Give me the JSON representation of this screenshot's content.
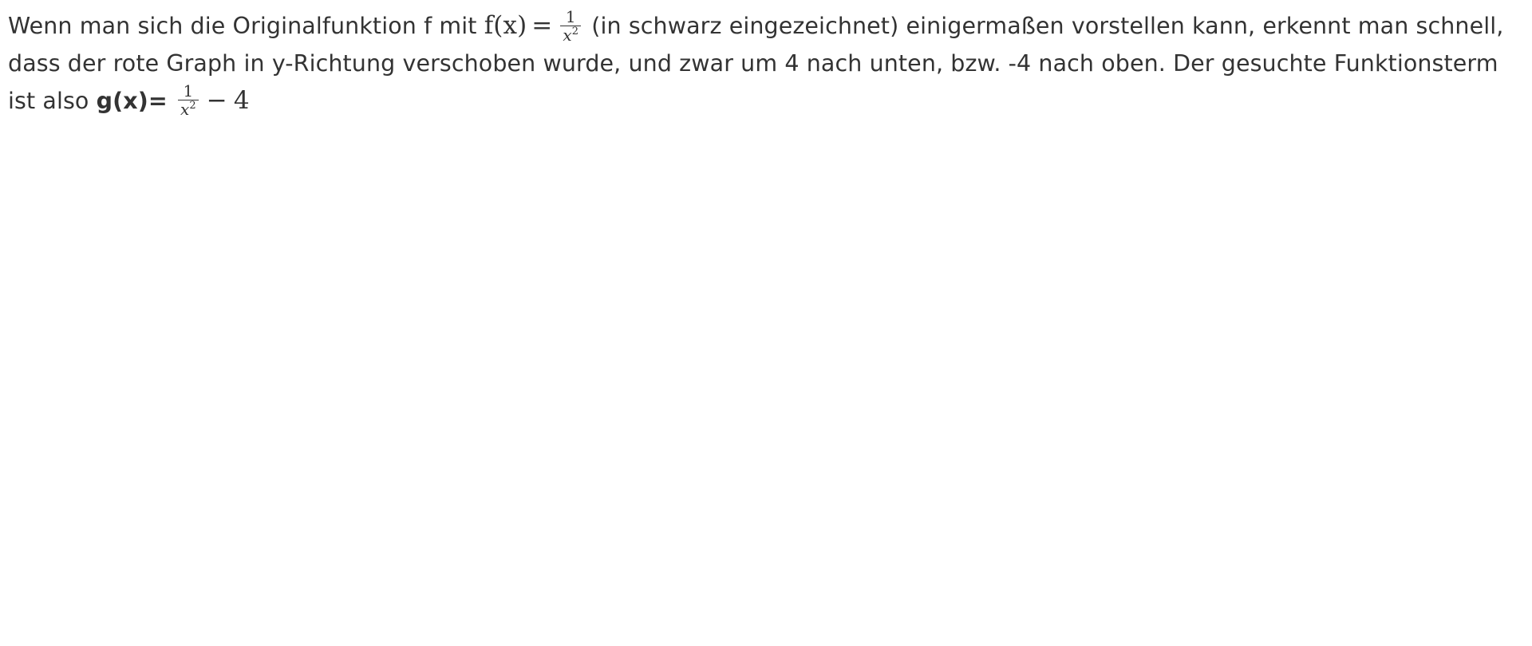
{
  "paragraph": {
    "text_1": "Wenn man sich die Originalfunktion f mit ",
    "f_name": "f",
    "f_lparen": "(",
    "f_var": "x",
    "f_rparen": ")",
    "equals": "=",
    "frac_1_numerator": "1",
    "frac_1_denominator": "x",
    "frac_1_exponent": "2",
    "text_2": " (in schwarz eingezeichnet) einigermaßen vorstellen kann, erkennt man schnell, dass der rote Graph in y-Richtung verschoben wurde, und zwar um 4 nach unten, bzw. -4 nach oben. Der gesuchte Funktionsterm ist also ",
    "answer_label": "g(x)=",
    "frac_2_numerator": "1",
    "frac_2_denominator": "x",
    "frac_2_exponent": "2",
    "minus_sign": "−",
    "constant": "4"
  }
}
